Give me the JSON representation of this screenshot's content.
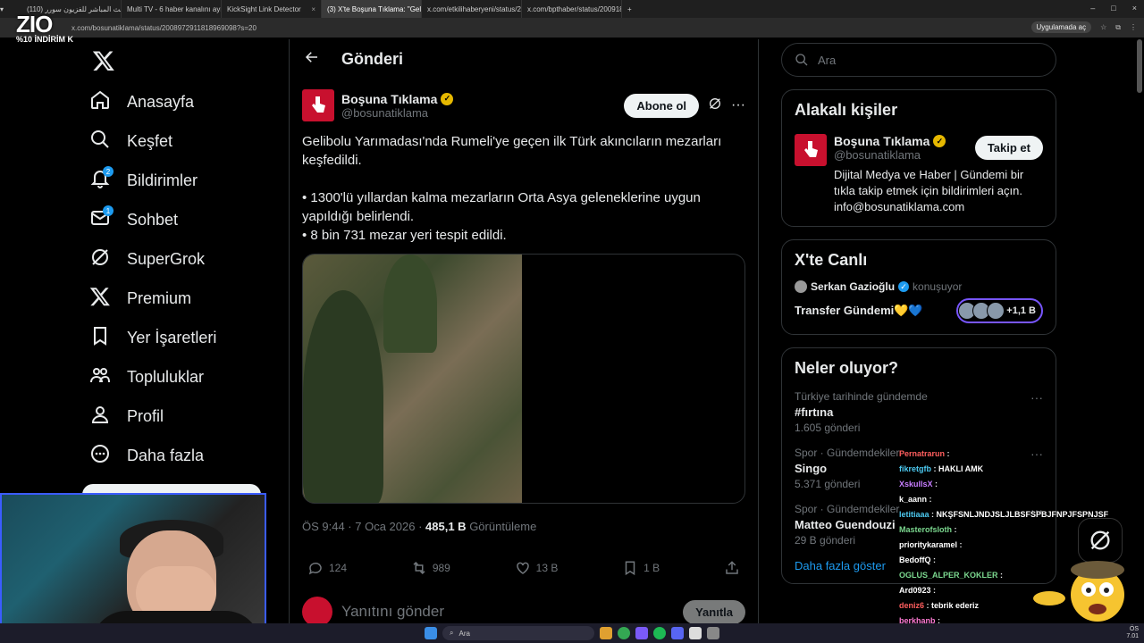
{
  "browser": {
    "tabs": [
      {
        "label": "(110) البث المباشر للفزيون سورر"
      },
      {
        "label": "Multi TV - 6 haber kanalını aynı"
      },
      {
        "label": "KickSight Link Detector"
      },
      {
        "label": "(3) X'te Boşuna Tıklama: \"Gelib",
        "active": true
      },
      {
        "label": "x.com/etkilihaberyeni/status/20"
      },
      {
        "label": "x.com/bpthaber/status/200918"
      }
    ],
    "url": "x.com/bosunatiklama/status/2008972911818969098?s=20",
    "app_button": "Uygulamada aç"
  },
  "stream_logo": {
    "brand": "ZIO",
    "promo": "%10 İNDİRİM K"
  },
  "nav": {
    "items": [
      {
        "label": "Anasayfa"
      },
      {
        "label": "Keşfet"
      },
      {
        "label": "Bildirimler",
        "badge": "2"
      },
      {
        "label": "Sohbet",
        "badge": "1"
      },
      {
        "label": "SuperGrok"
      },
      {
        "label": "Premium"
      },
      {
        "label": "Yer İşaretleri"
      },
      {
        "label": "Topluluklar"
      },
      {
        "label": "Profil"
      },
      {
        "label": "Daha fazla"
      }
    ]
  },
  "post": {
    "header_title": "Gönderi",
    "author_name": "Boşuna Tıklama",
    "author_handle": "@bosunatiklama",
    "subscribe_label": "Abone ol",
    "text_line1": "Gelibolu Yarımadası'nda Rumeli'ye geçen ilk Türk akıncıların mezarları keşfedildi.",
    "text_line2": "• 1300'lü yıllardan kalma mezarların Orta Asya geleneklerine uygun yapıldığı belirlendi.",
    "text_line3": "• 8 bin 731 mezar yeri tespit edildi.",
    "timestamp": "ÖS 9:44 · 7 Oca 2026 · ",
    "views_value": "485,1 B",
    "views_label": " Görüntüleme",
    "replies": "124",
    "reposts": "989",
    "likes": "13 B",
    "bookmarks": "1 B",
    "reply_placeholder": "Yanıtını gönder",
    "reply_button": "Yanıtla"
  },
  "sidebar": {
    "search_placeholder": "Ara",
    "related_title": "Alakalı kişiler",
    "related_name": "Boşuna Tıklama",
    "related_handle": "@bosunatiklama",
    "follow_label": "Takip et",
    "related_bio": "Dijital Medya ve Haber | Gündemi bir tıkla takip etmek için bildirimleri açın. info@bosunatiklama.com",
    "live_title": "X'te Canlı",
    "live_host": "Serkan Gazioğlu",
    "live_status": "konuşuyor",
    "live_topic": "Transfer Gündemi💛💙",
    "live_count": "+1,1 B",
    "trends_title": "Neler oluyor?",
    "trends": [
      {
        "context": "Türkiye tarihinde gündemde",
        "topic": "#fırtına",
        "count": "1.605 gönderi"
      },
      {
        "context": "Spor · Gündemdekiler",
        "topic": "Singo",
        "count": "5.371 gönderi"
      },
      {
        "context": "Spor · Gündemdekiler",
        "topic": "Matteo Guendouzi",
        "count": "29 B gönderi"
      }
    ],
    "show_more": "Daha fazla göster"
  },
  "chat": [
    {
      "user": "Pernatrarun",
      "msg": ""
    },
    {
      "user": "fikretgfb",
      "msg": "HAKLI AMK"
    },
    {
      "user": "XskullsX",
      "msg": ""
    },
    {
      "user": "k_aann",
      "msg": ""
    },
    {
      "user": "letitiaaa",
      "msg": "NKŞFSNLJNDJSLJLBSFSPBJFNPJFSPNJSF"
    },
    {
      "user": "Masterofsloth",
      "msg": ""
    },
    {
      "user": "prioritykaramel",
      "msg": ""
    },
    {
      "user": "BedoffQ",
      "msg": ""
    },
    {
      "user": "OGLUS_ALPER_KOKLER",
      "msg": ""
    },
    {
      "user": "Ard0923",
      "msg": ""
    },
    {
      "user": "deniz6",
      "msg": "tebrik ederiz"
    },
    {
      "user": "berkhanb",
      "msg": ""
    }
  ],
  "taskbar": {
    "search": "Ara",
    "clock_line1": "ÖS",
    "clock_line2": "7.01"
  },
  "colors": {
    "accent": "#1d9bf0",
    "background": "#000000",
    "border": "#2f3336",
    "muted": "#71767b"
  }
}
